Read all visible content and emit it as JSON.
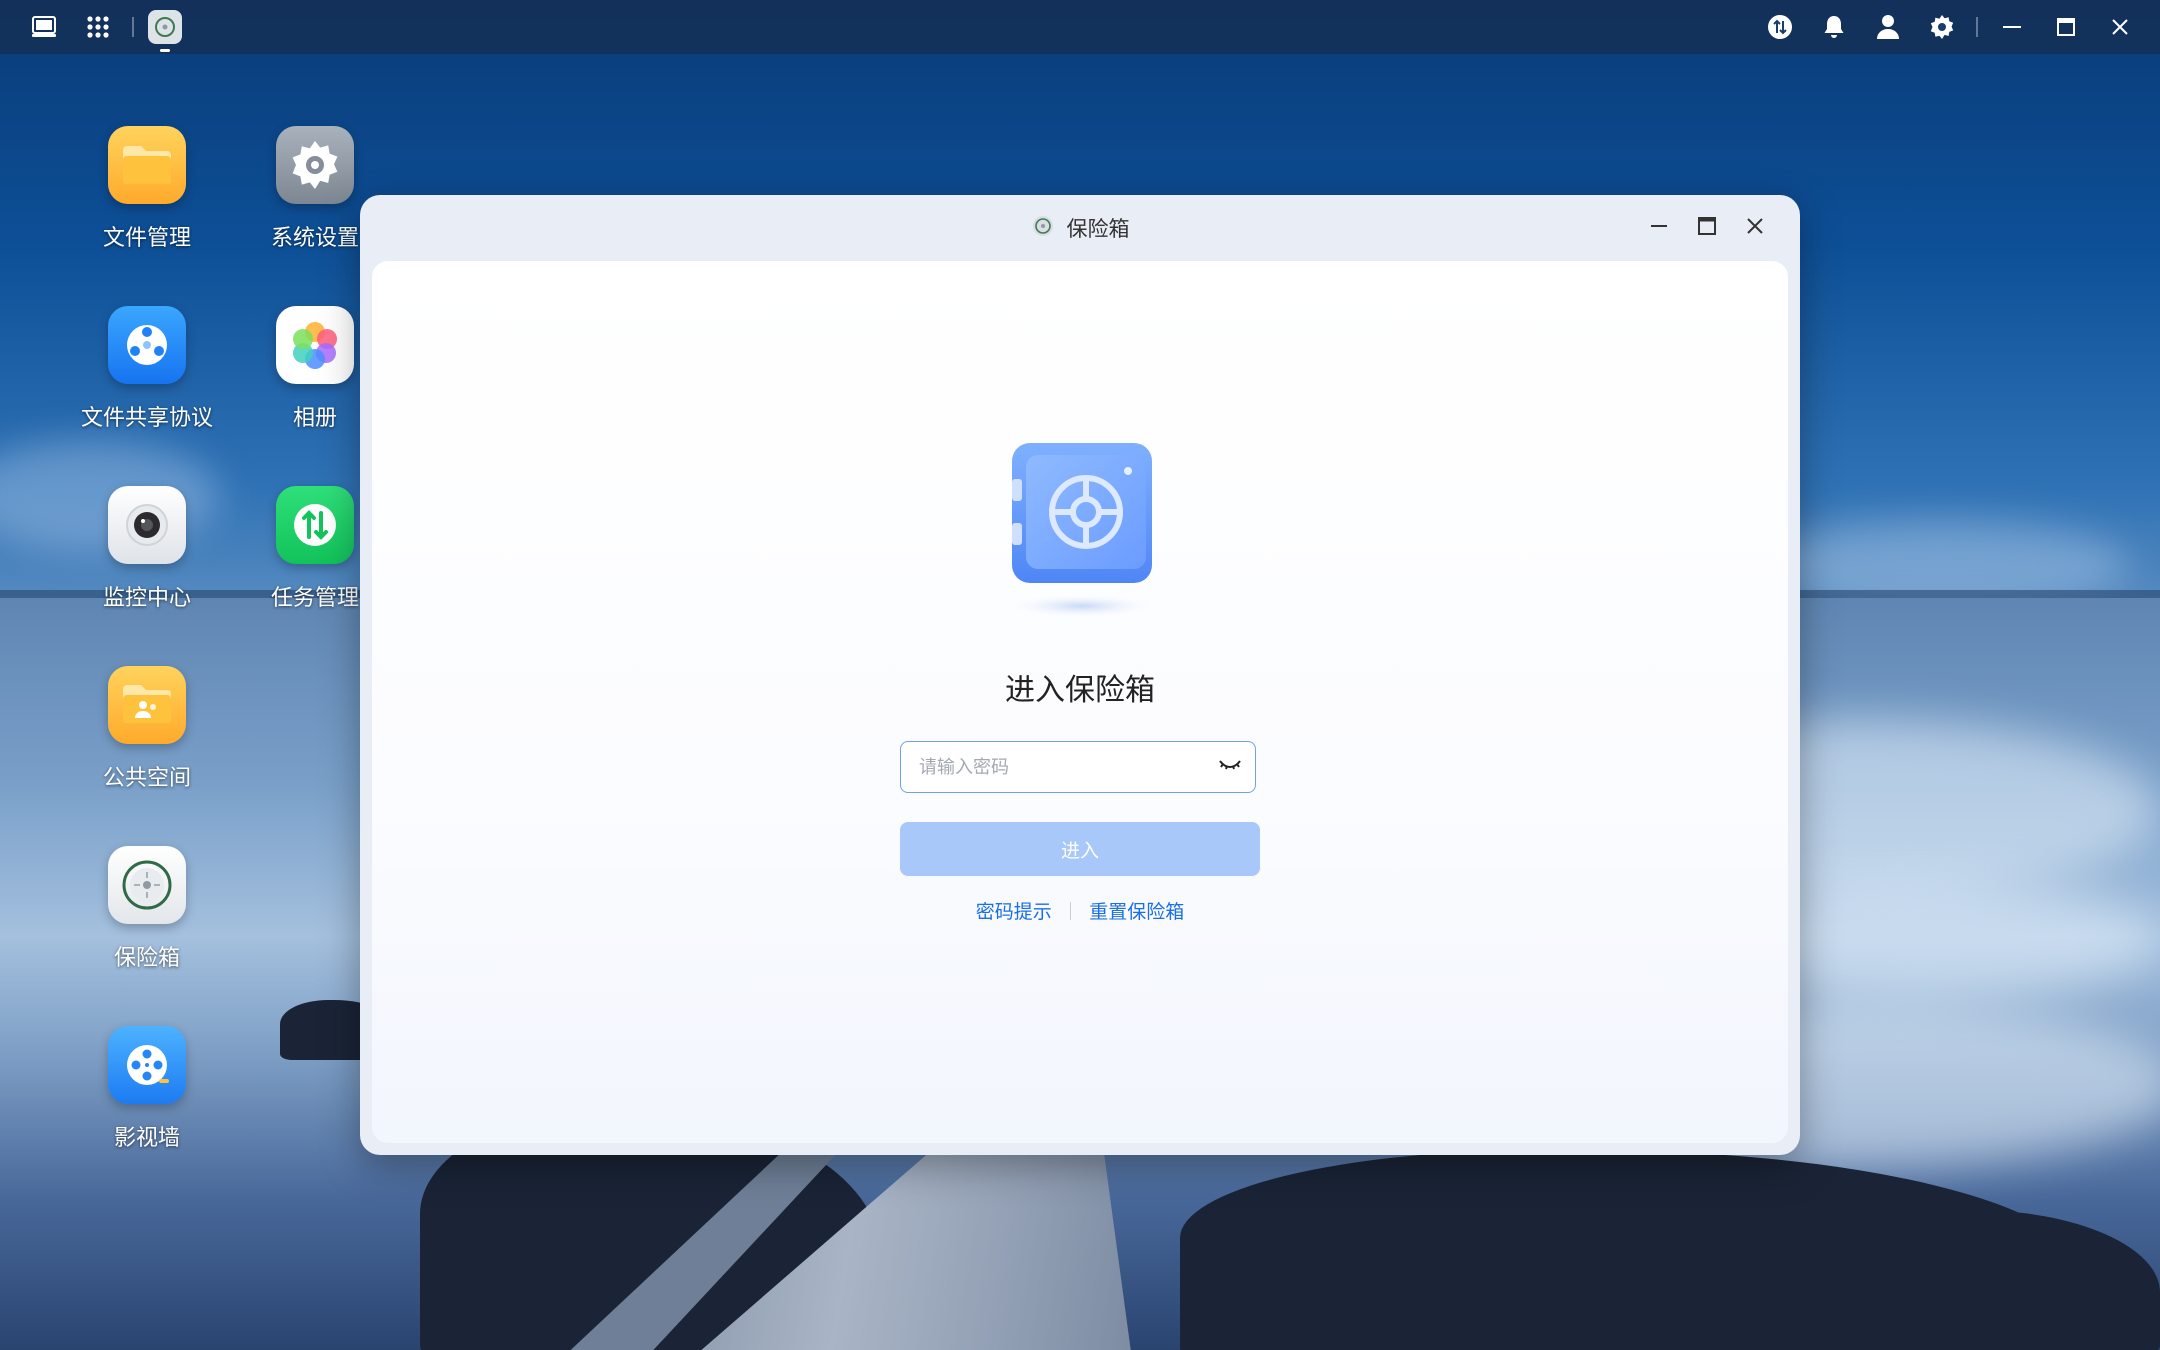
{
  "desktop": {
    "icons": [
      {
        "label": "文件管理"
      },
      {
        "label": "系统设置"
      },
      {
        "label": "文件共享协议"
      },
      {
        "label": "相册"
      },
      {
        "label": "监控中心"
      },
      {
        "label": "任务管理"
      },
      {
        "label": "公共空间"
      },
      {
        "label": "保险箱"
      },
      {
        "label": "影视墙"
      }
    ]
  },
  "topbar": {
    "left_icons": [
      "desktop-icon",
      "app-grid-icon"
    ],
    "running_app": "safe-app-icon",
    "right_icons": [
      "transfer-icon",
      "bell-icon",
      "user-icon",
      "gear-icon",
      "minimize-icon",
      "maximize-icon",
      "close-icon"
    ]
  },
  "window": {
    "title": "保险箱",
    "heading": "进入保险箱",
    "password": {
      "value": "",
      "placeholder": "请输入密码"
    },
    "enter_button": "进入",
    "links": {
      "hint": "密码提示",
      "reset": "重置保险箱"
    }
  },
  "colors": {
    "accent": "#1a6fe8",
    "button_disabled": "#a8c8fa",
    "input_border": "#6fa0f2",
    "topbar": "#143058"
  }
}
